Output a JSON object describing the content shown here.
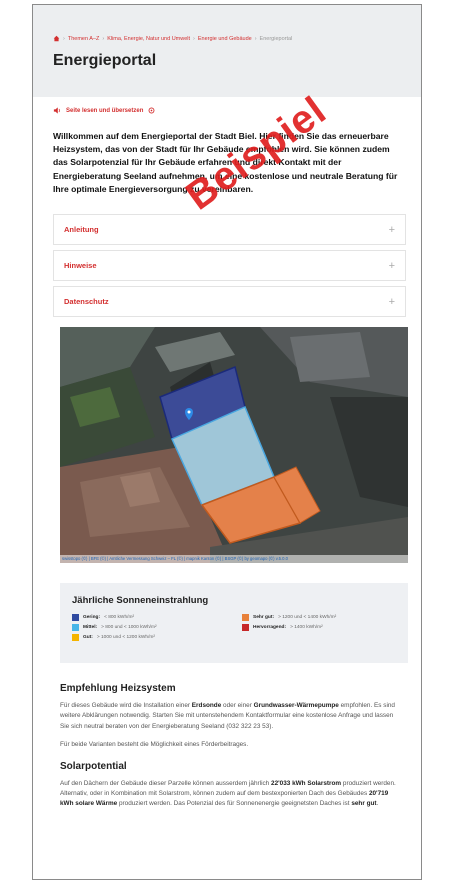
{
  "breadcrumb": {
    "items": [
      "Themen A–Z",
      "Klima, Energie, Natur und Umwelt",
      "Energie und Gebäude"
    ],
    "current": "Energieportal"
  },
  "page_title": "Energieportal",
  "read_aloud": "Seite lesen und übersetzen",
  "intro": "Willkommen auf dem Energieportal der Stadt Biel. Hier finden Sie das erneuerbare Heizsystem, das von der Stadt für Ihr Gebäude empfohlen wird. Sie können zudem das Solarpotenzial für Ihr Gebäude erfahren und direkt Kontakt mit der Energieberatung Seeland aufnehmen, um eine kostenlose und neutrale Beratung für Ihre optimale Energieversorgung zu vereinbaren.",
  "accordion": [
    {
      "label": "Anleitung"
    },
    {
      "label": "Hinweise"
    },
    {
      "label": "Datenschutz"
    }
  ],
  "stamp": "Beispiel",
  "map": {
    "attribution": "swisstopo (©) | BFE (©) | Amtliche Vermessung Schweiz – FL (©) | mapnik Kanton (©) | BSGP (©) by geomapo (©) v.5.0.0",
    "colors": {
      "roof_blue": "#3c4b97",
      "roof_light": "#9fc6d8",
      "roof_orange": "#e4814a"
    }
  },
  "legend": {
    "title": "Jährliche Sonneneinstrahlung",
    "items": [
      {
        "label": "Gering:",
        "range": "< 800 kWh/m²",
        "color": "#2f4aa0"
      },
      {
        "label": "Sehr gut:",
        "range": "> 1200 und < 1400 kWh/m²",
        "color": "#e8813a"
      },
      {
        "label": "Mittel:",
        "range": "> 800 und < 1000 kWh/m²",
        "color": "#47b5e8"
      },
      {
        "label": "Hervorragend:",
        "range": "> 1400 kWh/m²",
        "color": "#c62828"
      },
      {
        "label": "Gut:",
        "range": "> 1000 und < 1200 kWh/m²",
        "color": "#f4b400"
      }
    ]
  },
  "heating": {
    "title": "Empfehlung Heizsystem",
    "p1_a": "Für dieses Gebäude wird die Installation einer ",
    "p1_b": "Erdsonde",
    "p1_c": " oder einer ",
    "p1_d": "Grundwasser-Wärmepumpe",
    "p1_e": " empfohlen. Es sind weitere Abklärungen notwendig. Starten Sie mit untenstehendem Kontaktformular eine kostenlose Anfrage und lassen Sie sich neutral beraten von der Energieberatung Seeland (032 322 23 53).",
    "p2": "Für beide Varianten besteht die Möglichkeit eines Förderbeitrages."
  },
  "solar": {
    "title": "Solarpotential",
    "p_a": "Auf den Dächern der Gebäude dieser Parzelle können ausserdem jährlich ",
    "p_b": "22'033 kWh Solarstrom",
    "p_c": " produziert werden. Alternativ, oder in Kombination mit Solarstrom, können zudem auf dem bestexponierten Dach des Gebäudes ",
    "p_d": "20'719 kWh solare Wärme",
    "p_e": " produziert werden. Das Potenzial des für Sonnenenergie geeignetsten Daches ist ",
    "p_f": "sehr gut",
    "p_g": "."
  }
}
